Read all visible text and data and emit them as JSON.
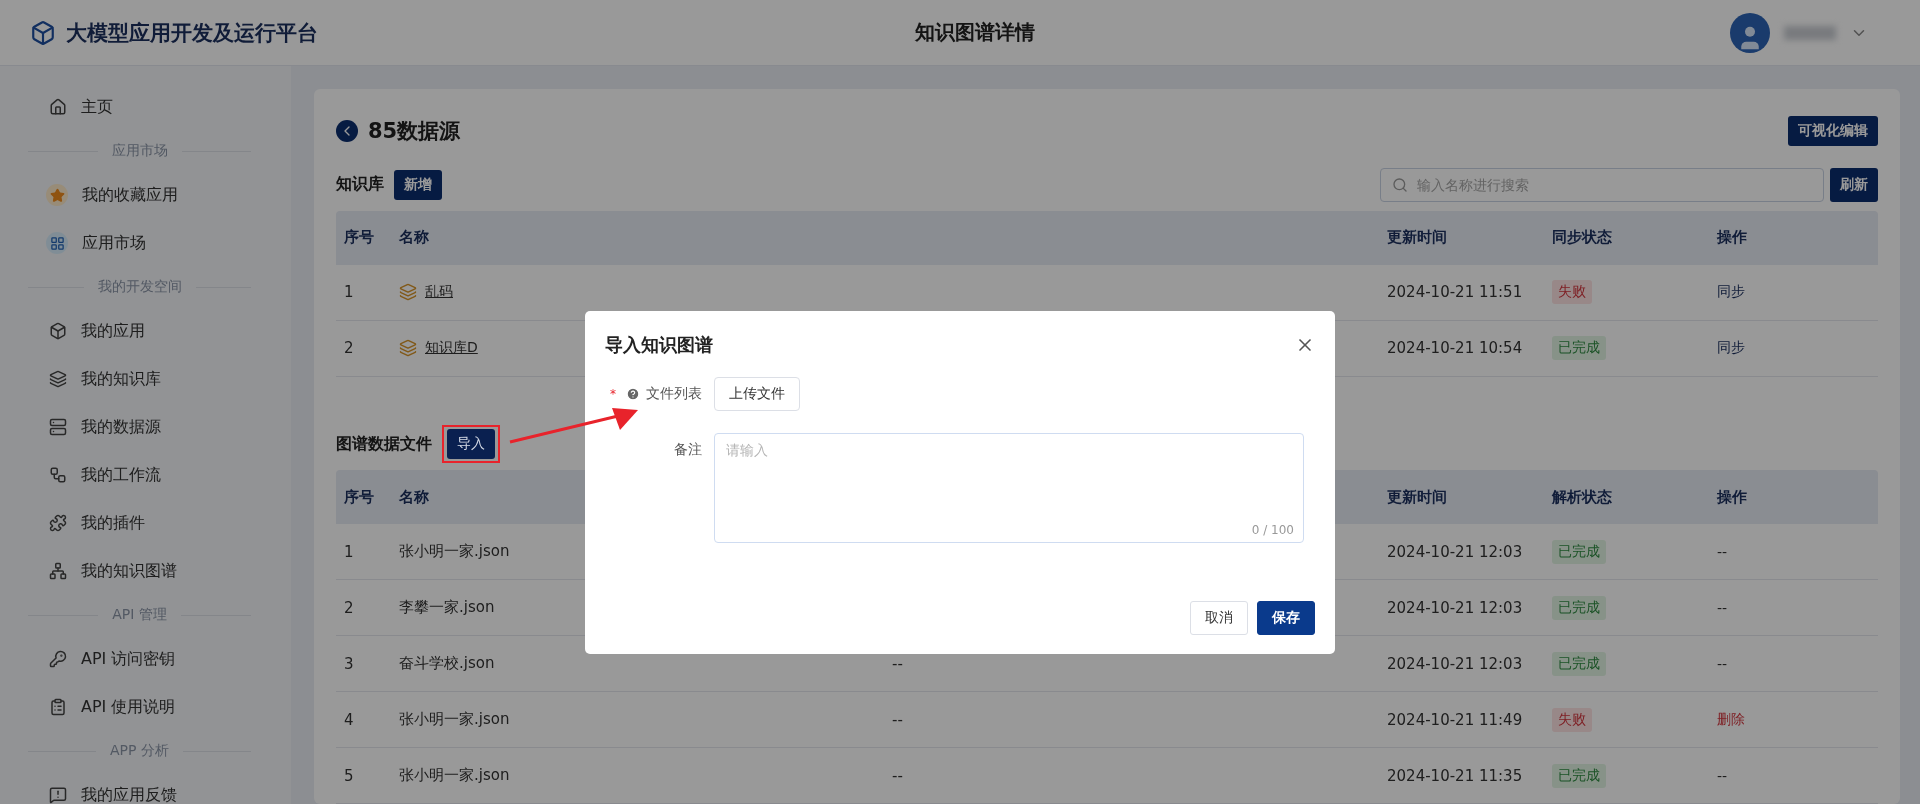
{
  "header": {
    "app_title": "大模型应用开发及运行平台",
    "page_title": "知识图谱详情"
  },
  "sidebar": {
    "items": [
      {
        "kind": "item",
        "label": "主页"
      },
      {
        "kind": "section",
        "label": "应用市场"
      },
      {
        "kind": "item",
        "label": "我的收藏应用"
      },
      {
        "kind": "item",
        "label": "应用市场"
      },
      {
        "kind": "section",
        "label": "我的开发空间"
      },
      {
        "kind": "item",
        "label": "我的应用"
      },
      {
        "kind": "item",
        "label": "我的知识库"
      },
      {
        "kind": "item",
        "label": "我的数据源"
      },
      {
        "kind": "item",
        "label": "我的工作流"
      },
      {
        "kind": "item",
        "label": "我的插件"
      },
      {
        "kind": "item",
        "label": "我的知识图谱"
      },
      {
        "kind": "section",
        "label": "API 管理"
      },
      {
        "kind": "item",
        "label": "API 访问密钥"
      },
      {
        "kind": "item",
        "label": "API 使用说明"
      },
      {
        "kind": "section",
        "label": "APP 分析"
      },
      {
        "kind": "item",
        "label": "我的应用反馈"
      }
    ]
  },
  "page": {
    "title": "85数据源",
    "visual_edit_button": "可视化编辑"
  },
  "knowledge_base": {
    "title": "知识库",
    "add_button": "新增",
    "search": {
      "placeholder": "输入名称进行搜索"
    },
    "refresh_button": "刷新",
    "columns": [
      "序号",
      "名称",
      "更新时间",
      "同步状态",
      "操作"
    ],
    "rows": [
      {
        "index": "1",
        "name": "乱码",
        "updated": "2024-10-21 11:51",
        "status": {
          "label": "失败",
          "kind": "failed"
        },
        "action": {
          "label": "同步",
          "kind": "link"
        }
      },
      {
        "index": "2",
        "name": "知识库D",
        "updated": "2024-10-21 10:54",
        "status": {
          "label": "已完成",
          "kind": "done"
        },
        "action": {
          "label": "同步",
          "kind": "link"
        }
      }
    ]
  },
  "graph_files": {
    "title": "图谱数据文件",
    "import_button": "导入",
    "columns": [
      "序号",
      "名称",
      "更新时间",
      "解析状态",
      "操作"
    ],
    "rows": [
      {
        "index": "1",
        "name": "张小明一家.json",
        "updated": "2024-10-21 12:03",
        "status": {
          "label": "已完成",
          "kind": "done"
        },
        "action": {
          "label": "--",
          "kind": "none"
        }
      },
      {
        "index": "2",
        "name": "李攀一家.json",
        "updated": "2024-10-21 12:03",
        "status": {
          "label": "已完成",
          "kind": "done"
        },
        "action": {
          "label": "--",
          "kind": "none"
        }
      },
      {
        "index": "3",
        "name": "奋斗学校.json",
        "column_3": "--",
        "updated": "2024-10-21 12:03",
        "status": {
          "label": "已完成",
          "kind": "done"
        },
        "action": {
          "label": "--",
          "kind": "none"
        }
      },
      {
        "index": "4",
        "name": "张小明一家.json",
        "column_3": "--",
        "updated": "2024-10-21 11:49",
        "status": {
          "label": "失败",
          "kind": "failed"
        },
        "action": {
          "label": "删除",
          "kind": "danger"
        }
      },
      {
        "index": "5",
        "name": "张小明一家.json",
        "column_3": "--",
        "updated": "2024-10-21 11:35",
        "status": {
          "label": "已完成",
          "kind": "done"
        },
        "action": {
          "label": "--",
          "kind": "none"
        }
      }
    ]
  },
  "dialog": {
    "title": "导入知识图谱",
    "file_list": {
      "required_mark": "*",
      "label": "文件列表",
      "upload_button": "上传文件"
    },
    "remark": {
      "label": "备注",
      "placeholder": "请输入",
      "counter": "0 / 100"
    },
    "buttons": [
      {
        "label": "取消",
        "kind": "default"
      },
      {
        "label": "保存",
        "kind": "primary"
      }
    ]
  }
}
